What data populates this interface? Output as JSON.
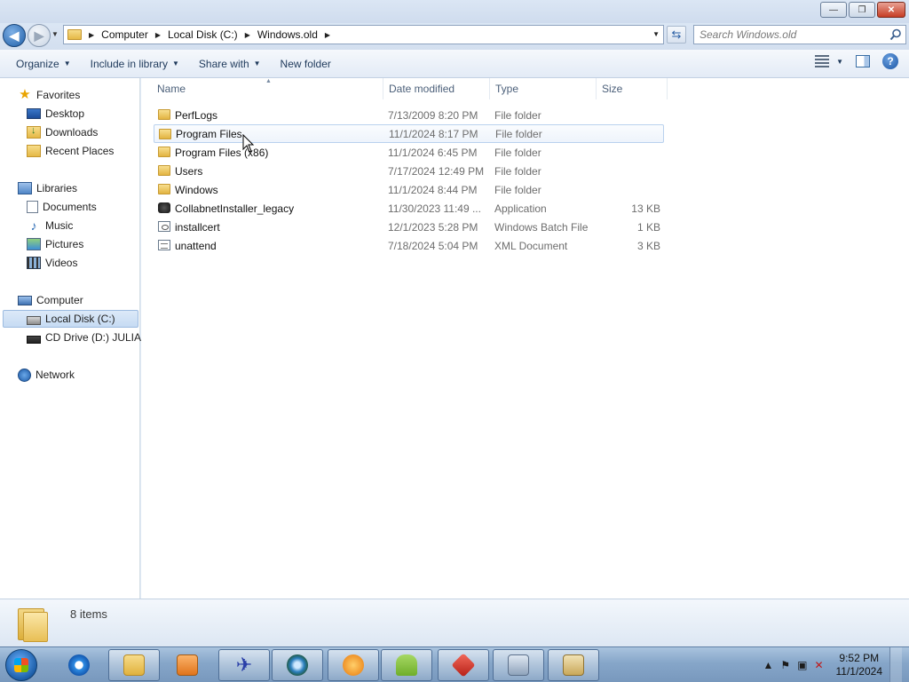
{
  "window": {
    "minimize_label": "—",
    "maximize_label": "❐",
    "close_label": "✕"
  },
  "address": {
    "crumbs": [
      "Computer",
      "Local Disk (C:)",
      "Windows.old"
    ],
    "search_placeholder": "Search Windows.old"
  },
  "toolbar": {
    "organize": "Organize",
    "include_in_library": "Include in library",
    "share_with": "Share with",
    "new_folder": "New folder",
    "help": "?"
  },
  "nav": {
    "favorites": "Favorites",
    "desktop": "Desktop",
    "downloads": "Downloads",
    "recent_places": "Recent Places",
    "libraries": "Libraries",
    "documents": "Documents",
    "music": "Music",
    "pictures": "Pictures",
    "videos": "Videos",
    "computer": "Computer",
    "local_disk": "Local Disk (C:)",
    "cd_drive": "CD Drive (D:) JULIA",
    "network": "Network"
  },
  "columns": {
    "name": "Name",
    "date_modified": "Date modified",
    "type": "Type",
    "size": "Size"
  },
  "files": [
    {
      "name": "PerfLogs",
      "date": "7/13/2009 8:20 PM",
      "type": "File folder",
      "size": "",
      "icon": "folder-icon"
    },
    {
      "name": "Program Files",
      "date": "11/1/2024 8:17 PM",
      "type": "File folder",
      "size": "",
      "icon": "folder-icon"
    },
    {
      "name": "Program Files (x86)",
      "date": "11/1/2024 6:45 PM",
      "type": "File folder",
      "size": "",
      "icon": "folder-icon"
    },
    {
      "name": "Users",
      "date": "7/17/2024 12:49 PM",
      "type": "File folder",
      "size": "",
      "icon": "folder-icon"
    },
    {
      "name": "Windows",
      "date": "11/1/2024 8:44 PM",
      "type": "File folder",
      "size": "",
      "icon": "folder-icon"
    },
    {
      "name": "CollabnetInstaller_legacy",
      "date": "11/30/2023 11:49 ...",
      "type": "Application",
      "size": "13 KB",
      "icon": "application-icon"
    },
    {
      "name": "installcert",
      "date": "12/1/2023 5:28 PM",
      "type": "Windows Batch File",
      "size": "1 KB",
      "icon": "batch-file-icon"
    },
    {
      "name": "unattend",
      "date": "7/18/2024 5:04 PM",
      "type": "XML Document",
      "size": "3 KB",
      "icon": "xml-document-icon"
    }
  ],
  "details": {
    "item_count": "8 items"
  },
  "taskbar": {
    "time": "9:52 PM",
    "date": "11/1/2024"
  }
}
